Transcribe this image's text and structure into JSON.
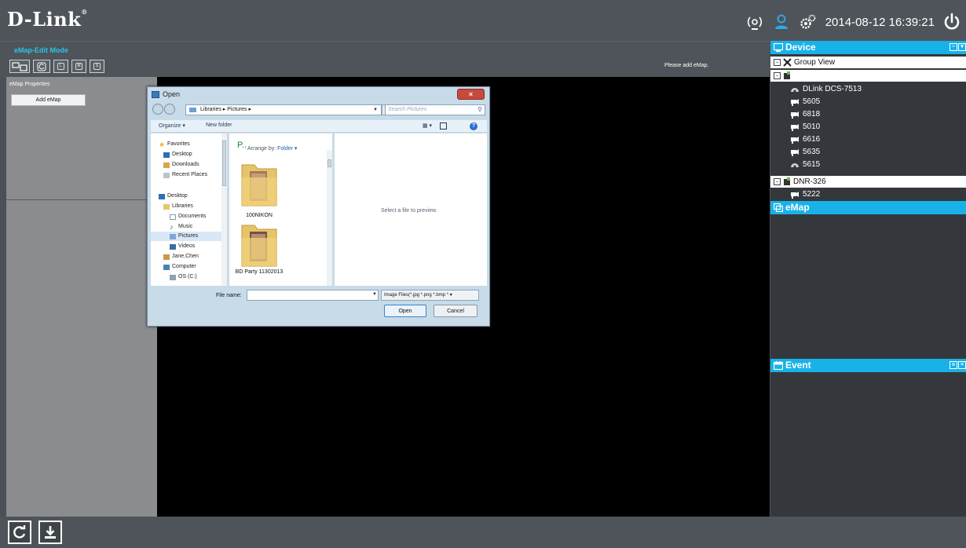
{
  "app": {
    "logo": "D-Link",
    "datetime": "2014-08-12 16:39:21"
  },
  "modebar": {
    "title": "eMap-Edit Mode",
    "tools": [
      "camera-group-tool",
      "refresh-tool",
      "L",
      "M",
      "S"
    ],
    "notice": "Please add eMap."
  },
  "properties": {
    "title": "eMap Properties",
    "add_button": "Add eMap"
  },
  "device_panel": {
    "title": "Device",
    "group_view": "Group View",
    "group1_devices": [
      "DLink DCS-7513",
      "5605",
      "6818",
      "5010",
      "6616",
      "5635",
      "5615"
    ],
    "nvr_name": "DNR-326",
    "nvr_devices": [
      "5222"
    ]
  },
  "emap_panel": {
    "title": "eMap"
  },
  "event_panel": {
    "title": "Event"
  },
  "dialog": {
    "title": "Open",
    "breadcrumb": "Libraries ▸ Pictures ▸",
    "search_placeholder": "Search Pictures",
    "organize": "Organize ▾",
    "new_folder": "New folder",
    "nav": {
      "favorites": "Favorites",
      "desktop": "Desktop",
      "downloads": "Downloads",
      "recent": "Recent Places",
      "desktop2": "Desktop",
      "libraries": "Libraries",
      "documents": "Documents",
      "music": "Music",
      "pictures": "Pictures",
      "videos": "Videos",
      "user": "Jane.Chen",
      "computer": "Computer",
      "os": "OS (C:)"
    },
    "library_title": "P..",
    "arrange_label": "Arrange by:",
    "arrange_value": "Folder ▾",
    "folders": [
      "100NIKON",
      "BD Party 11302013"
    ],
    "preview_text": "Select a file to preview.",
    "filename_label": "File name:",
    "filename_value": "",
    "filetype": "Image Files(*.jpg *.png *.bmp *",
    "open_label": "Open",
    "cancel_label": "Cancel"
  },
  "colors": {
    "accent": "#19b2e8",
    "mode_title": "#27c6ea",
    "toolbar_bg": "#4e5459",
    "canvas": "#000000"
  }
}
